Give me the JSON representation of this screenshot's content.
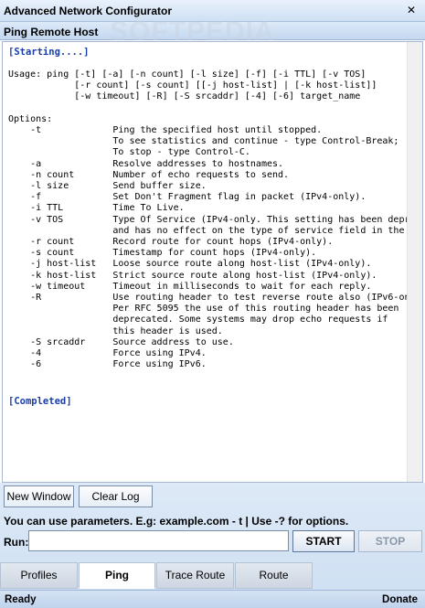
{
  "window": {
    "title": "Advanced Network Configurator",
    "close_glyph": "✕",
    "watermark": "SOFTPEDIA"
  },
  "panel": {
    "title": "Ping Remote Host"
  },
  "output": {
    "start_status": "[Starting....]",
    "body": "Usage: ping [-t] [-a] [-n count] [-l size] [-f] [-i TTL] [-v TOS]\n            [-r count] [-s count] [[-j host-list] | [-k host-list]]\n            [-w timeout] [-R] [-S srcaddr] [-4] [-6] target_name\n\nOptions:\n    -t             Ping the specified host until stopped.\n                   To see statistics and continue - type Control-Break;\n                   To stop - type Control-C.\n    -a             Resolve addresses to hostnames.\n    -n count       Number of echo requests to send.\n    -l size        Send buffer size.\n    -f             Set Don't Fragment flag in packet (IPv4-only).\n    -i TTL         Time To Live.\n    -v TOS         Type Of Service (IPv4-only. This setting has been depr\n                   and has no effect on the type of service field in the\n    -r count       Record route for count hops (IPv4-only).\n    -s count       Timestamp for count hops (IPv4-only).\n    -j host-list   Loose source route along host-list (IPv4-only).\n    -k host-list   Strict source route along host-list (IPv4-only).\n    -w timeout     Timeout in milliseconds to wait for each reply.\n    -R             Use routing header to test reverse route also (IPv6-on\n                   Per RFC 5095 the use of this routing header has been\n                   deprecated. Some systems may drop echo requests if\n                   this header is used.\n    -S srcaddr     Source address to use.\n    -4             Force using IPv4.\n    -6             Force using IPv6.",
    "end_status": "[Completed]"
  },
  "toolbar": {
    "new_window_label": "New Window",
    "clear_log_label": "Clear Log"
  },
  "hint_text": "You can use parameters. E.g: example.com - t | Use -? for options.",
  "run": {
    "label": "Run:",
    "value": "",
    "start_label": "START",
    "stop_label": "STOP"
  },
  "tabs": [
    {
      "label": "Profiles",
      "active": false
    },
    {
      "label": "Ping",
      "active": true
    },
    {
      "label": "Trace Route",
      "active": false
    },
    {
      "label": "Route",
      "active": false
    }
  ],
  "statusbar": {
    "left": "Ready",
    "right": "Donate"
  },
  "colors": {
    "status_text": "#1a3ea8",
    "chrome": "#cfe0f3"
  }
}
